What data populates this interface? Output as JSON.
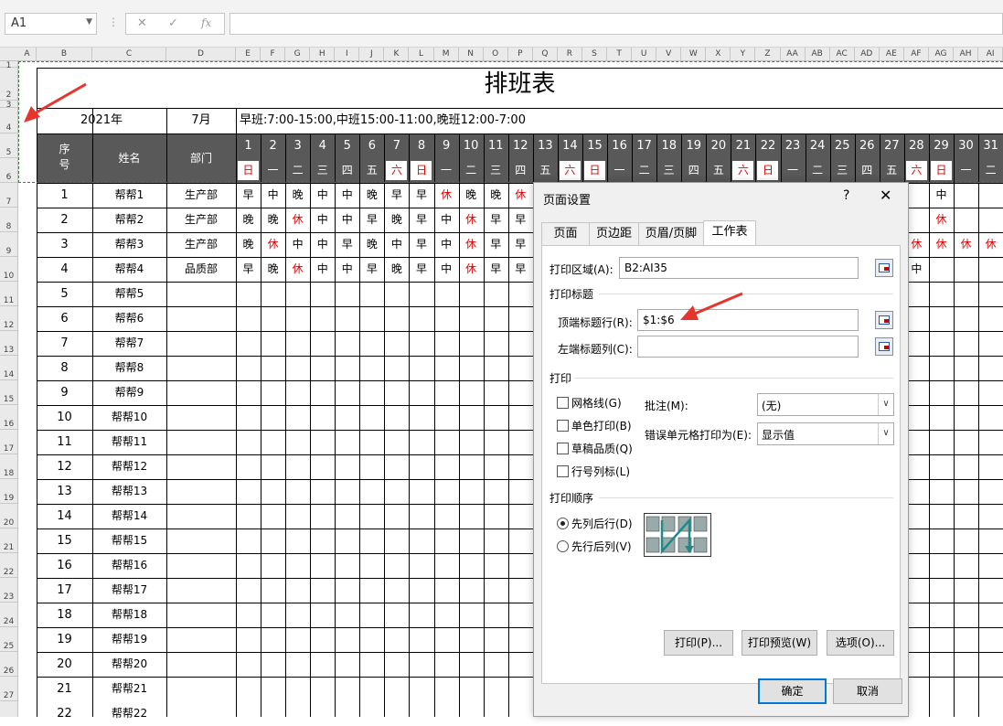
{
  "formula_bar": {
    "name_box": "A1",
    "fx": "fx",
    "cancel": "✕",
    "confirm": "✓",
    "formula": ""
  },
  "columns": [
    "A",
    "B",
    "C",
    "D",
    "E",
    "F",
    "G",
    "H",
    "I",
    "J",
    "K",
    "L",
    "M",
    "N",
    "O",
    "P",
    "Q",
    "R",
    "S",
    "T",
    "U",
    "V",
    "W",
    "X",
    "Y",
    "Z",
    "AA",
    "AB",
    "AC",
    "AD",
    "AE",
    "AF",
    "AG",
    "AH",
    "AI"
  ],
  "rows": [
    "1",
    "2",
    "3",
    "4",
    "5",
    "6",
    "7",
    "8",
    "9",
    "10",
    "11",
    "12",
    "13",
    "14",
    "15",
    "16",
    "17",
    "18",
    "19",
    "20",
    "21",
    "22",
    "23",
    "24",
    "25",
    "26",
    "27"
  ],
  "sheet": {
    "title": "排班表",
    "year": "2021年",
    "month": "7月",
    "shift_note": "早班:7:00-15:00,中班15:00-11:00,晚班12:00-7:00",
    "hdr_no": "序\n号",
    "hdr_name": "姓名",
    "hdr_dept": "部门",
    "days": [
      "1",
      "2",
      "3",
      "4",
      "5",
      "6",
      "7",
      "8",
      "9",
      "10",
      "11",
      "12",
      "13",
      "14",
      "15",
      "16",
      "17",
      "18",
      "19",
      "20",
      "21",
      "22",
      "23",
      "24",
      "25",
      "26",
      "27",
      "28",
      "29",
      "30",
      "31"
    ],
    "weekdays": [
      "日",
      "一",
      "二",
      "三",
      "四",
      "五",
      "六",
      "日",
      "一",
      "二",
      "三",
      "四",
      "五",
      "六",
      "日",
      "一",
      "二",
      "三",
      "四",
      "五",
      "六",
      "日",
      "一",
      "二",
      "三",
      "四",
      "五",
      "六",
      "日",
      "一",
      "二"
    ],
    "people": [
      {
        "no": "1",
        "name": "帮帮1",
        "dept": "生产部",
        "shifts": [
          "早",
          "中",
          "晚",
          "中",
          "中",
          "晚",
          "早",
          "早",
          "休",
          "晚",
          "晚",
          "休",
          "",
          "",
          "",
          "",
          "",
          "",
          "",
          "",
          "",
          "",
          "",
          "",
          "",
          "",
          "",
          "",
          "中",
          "",
          ""
        ]
      },
      {
        "no": "2",
        "name": "帮帮2",
        "dept": "生产部",
        "shifts": [
          "晚",
          "晚",
          "休",
          "中",
          "中",
          "早",
          "晚",
          "早",
          "中",
          "休",
          "早",
          "早",
          "",
          "",
          "",
          "",
          "",
          "",
          "",
          "",
          "",
          "",
          "",
          "",
          "",
          "",
          "",
          "",
          "休",
          "",
          ""
        ]
      },
      {
        "no": "3",
        "name": "帮帮3",
        "dept": "生产部",
        "shifts": [
          "晚",
          "休",
          "中",
          "中",
          "早",
          "晚",
          "中",
          "早",
          "中",
          "休",
          "早",
          "早",
          "",
          "",
          "",
          "",
          "",
          "",
          "",
          "",
          "",
          "",
          "",
          "",
          "",
          "",
          "",
          "休",
          "休",
          "休",
          "休"
        ]
      },
      {
        "no": "4",
        "name": "帮帮4",
        "dept": "品质部",
        "shifts": [
          "早",
          "晚",
          "休",
          "中",
          "中",
          "早",
          "晚",
          "早",
          "中",
          "休",
          "早",
          "早",
          "",
          "",
          "",
          "",
          "",
          "",
          "",
          "",
          "",
          "",
          "",
          "",
          "",
          "",
          "",
          "中",
          "",
          "",
          ""
        ]
      },
      {
        "no": "5",
        "name": "帮帮5",
        "dept": "",
        "shifts": []
      },
      {
        "no": "6",
        "name": "帮帮6",
        "dept": "",
        "shifts": []
      },
      {
        "no": "7",
        "name": "帮帮7",
        "dept": "",
        "shifts": []
      },
      {
        "no": "8",
        "name": "帮帮8",
        "dept": "",
        "shifts": []
      },
      {
        "no": "9",
        "name": "帮帮9",
        "dept": "",
        "shifts": []
      },
      {
        "no": "10",
        "name": "帮帮10",
        "dept": "",
        "shifts": []
      },
      {
        "no": "11",
        "name": "帮帮11",
        "dept": "",
        "shifts": []
      },
      {
        "no": "12",
        "name": "帮帮12",
        "dept": "",
        "shifts": []
      },
      {
        "no": "13",
        "name": "帮帮13",
        "dept": "",
        "shifts": []
      },
      {
        "no": "14",
        "name": "帮帮14",
        "dept": "",
        "shifts": []
      },
      {
        "no": "15",
        "name": "帮帮15",
        "dept": "",
        "shifts": []
      },
      {
        "no": "16",
        "name": "帮帮16",
        "dept": "",
        "shifts": []
      },
      {
        "no": "17",
        "name": "帮帮17",
        "dept": "",
        "shifts": []
      },
      {
        "no": "18",
        "name": "帮帮18",
        "dept": "",
        "shifts": []
      },
      {
        "no": "19",
        "name": "帮帮19",
        "dept": "",
        "shifts": []
      },
      {
        "no": "20",
        "name": "帮帮20",
        "dept": "",
        "shifts": []
      },
      {
        "no": "21",
        "name": "帮帮21",
        "dept": "",
        "shifts": []
      },
      {
        "no": "22",
        "name": "帮帮22",
        "dept": "",
        "shifts": []
      }
    ],
    "rest_label": "休",
    "colors": {
      "header_bg": "#595959",
      "red": "#e40000",
      "page_break": "#3f7e3f",
      "arrow": "#e8352b"
    }
  },
  "dialog": {
    "title": "页面设置",
    "help": "?",
    "close": "✕",
    "tabs": [
      "页面",
      "页边距",
      "页眉/页脚",
      "工作表"
    ],
    "active_tab": "工作表",
    "print_area_label": "打印区域(A):",
    "print_area_value": "B2:AI35",
    "print_titles_section": "打印标题",
    "top_rows_label": "顶端标题行(R):",
    "top_rows_value": "$1:$6",
    "left_cols_label": "左端标题列(C):",
    "left_cols_value": "",
    "print_section": "打印",
    "gridlines": "网格线(G)",
    "mono": "单色打印(B)",
    "draft": "草稿品质(Q)",
    "headings": "行号列标(L)",
    "comments_label": "批注(M):",
    "comments_value": "(无)",
    "errors_label": "错误单元格打印为(E):",
    "errors_value": "显示值",
    "order_section": "打印顺序",
    "down_then_over": "先列后行(D)",
    "over_then_down": "先行后列(V)",
    "print_btn": "打印(P)...",
    "preview_btn": "打印预览(W)",
    "options_btn": "选项(O)...",
    "ok_btn": "确定",
    "cancel_btn": "取消"
  }
}
